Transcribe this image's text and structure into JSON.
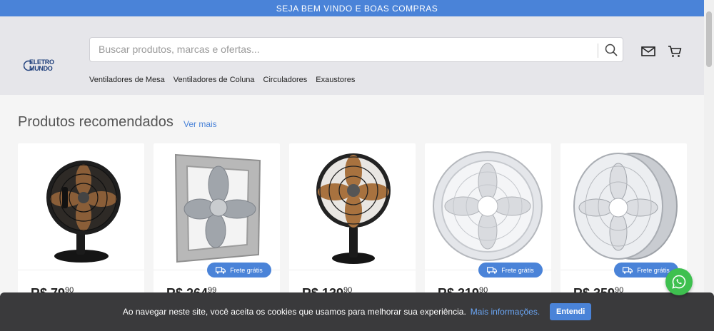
{
  "topbar": {
    "text": "SEJA BEM VINDO E BOAS COMPRAS"
  },
  "header": {
    "logo_line1": "ELETRO",
    "logo_line2": "MUNDO",
    "search_placeholder": "Buscar produtos, marcas e ofertas..."
  },
  "nav": {
    "items": [
      {
        "label": "Ventiladores de Mesa"
      },
      {
        "label": "Ventiladores de Coluna"
      },
      {
        "label": "Circuladores"
      },
      {
        "label": "Exaustores"
      }
    ]
  },
  "section": {
    "title": "Produtos recomendados",
    "see_more": "Ver mais"
  },
  "products": [
    {
      "price_main": "R$ 79",
      "price_cents": "90",
      "badge": ""
    },
    {
      "price_main": "R$ 264",
      "price_cents": "99",
      "badge": "Frete grátis"
    },
    {
      "price_main": "R$ 139",
      "price_cents": "90",
      "badge": ""
    },
    {
      "price_main": "R$ 319",
      "price_cents": "90",
      "badge": "Frete grátis"
    },
    {
      "price_main": "R$ 359",
      "price_cents": "90",
      "badge": "Frete grátis"
    }
  ],
  "cookie": {
    "message": "Ao navegar neste site, você aceita os cookies que usamos para melhorar sua experiência.",
    "more": "Mais informações.",
    "accept": "Entendi"
  },
  "colors": {
    "accent": "#4a83d8",
    "header_bg": "#e6e6ea",
    "whatsapp": "#3ec04f",
    "cookie_bg": "#3a3a3c"
  },
  "icons": {
    "search": "search-icon",
    "mail": "mail-icon",
    "cart": "cart-icon",
    "truck": "truck-icon",
    "whatsapp": "whatsapp-icon"
  }
}
